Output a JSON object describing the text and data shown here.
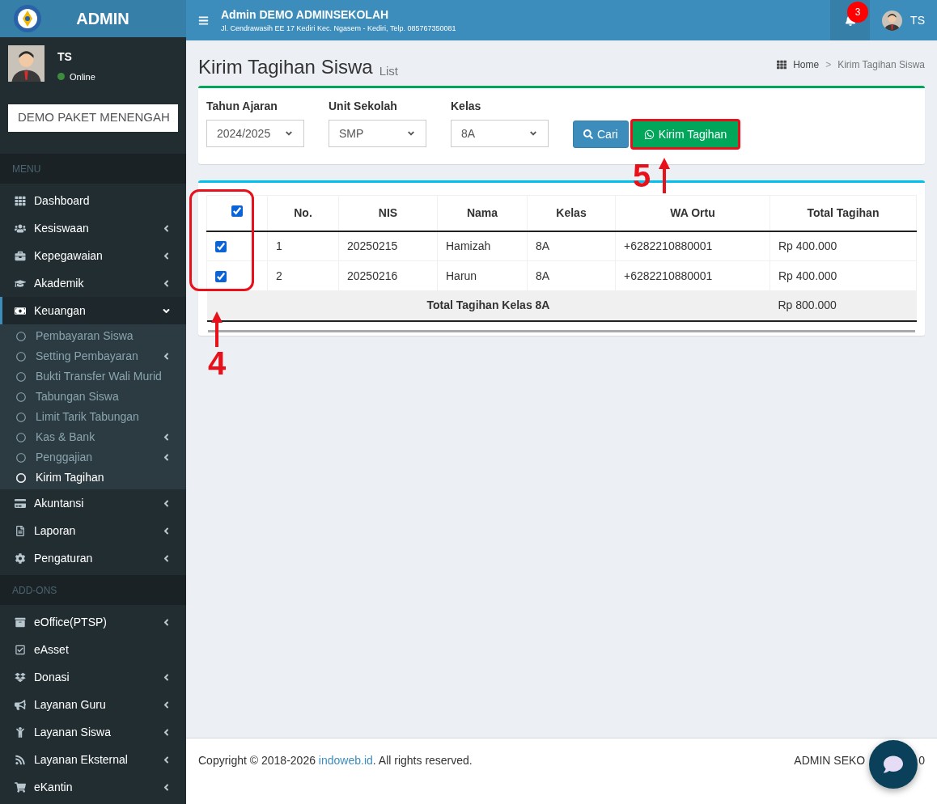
{
  "brand": {
    "title": "ADMIN"
  },
  "navbar": {
    "school": "Admin DEMO ADMINSEKOLAH",
    "address": "Jl. Cendrawasih EE 17 Kediri Kec. Ngasem - Kediri, Telp. 085767350081",
    "notifications": "3",
    "user": "TS"
  },
  "user_panel": {
    "name": "TS",
    "status": "Online"
  },
  "package_select": {
    "value": "DEMO PAKET MENENGAH"
  },
  "sidebar": [
    {
      "header": "MENU",
      "items": [
        {
          "label": "Dashboard",
          "selected": false
        },
        {
          "label": "Kesiswaan",
          "selected": false,
          "expanded": false
        },
        {
          "label": "Kepegawaian",
          "selected": false,
          "expanded": false
        },
        {
          "label": "Akademik",
          "selected": false,
          "expanded": false
        },
        {
          "label": "Keuangan",
          "selected": true,
          "expanded": true,
          "children": [
            {
              "label": "Pembayaran Siswa",
              "selected": false
            },
            {
              "label": "Setting Pembayaran",
              "selected": false,
              "expanded": false
            },
            {
              "label": "Bukti Transfer Wali Murid",
              "selected": false
            },
            {
              "label": "Tabungan Siswa",
              "selected": false
            },
            {
              "label": "Limit Tarik Tabungan",
              "selected": false
            },
            {
              "label": "Kas & Bank",
              "selected": false,
              "expanded": false
            },
            {
              "label": "Penggajian",
              "selected": false,
              "expanded": false
            },
            {
              "label": "Kirim Tagihan",
              "selected": true
            }
          ]
        },
        {
          "label": "Akuntansi",
          "selected": false,
          "expanded": false
        },
        {
          "label": "Laporan",
          "selected": false,
          "expanded": false
        },
        {
          "label": "Pengaturan",
          "selected": false,
          "expanded": false
        }
      ]
    },
    {
      "header": "ADD-ONS",
      "items": [
        {
          "label": "eOffice(PTSP)",
          "selected": false,
          "expanded": false
        },
        {
          "label": "eAsset",
          "selected": false
        },
        {
          "label": "Donasi",
          "selected": false,
          "expanded": false
        },
        {
          "label": "Layanan Guru",
          "selected": false,
          "expanded": false
        },
        {
          "label": "Layanan Siswa",
          "selected": false,
          "expanded": false
        },
        {
          "label": "Layanan Eksternal",
          "selected": false,
          "expanded": false
        },
        {
          "label": "eKantin",
          "selected": false,
          "expanded": false
        }
      ]
    }
  ],
  "page": {
    "title": "Kirim Tagihan Siswa",
    "subtitle": "List"
  },
  "breadcrumb": [
    {
      "label": "Home"
    },
    {
      "label": "Kirim Tagihan Siswa"
    }
  ],
  "breadcrumb_separator": ">",
  "filters": [
    {
      "label": "Tahun Ajaran",
      "value": "2024/2025"
    },
    {
      "label": "Unit Sekolah",
      "value": "SMP"
    },
    {
      "label": "Kelas",
      "value": "8A"
    }
  ],
  "buttons": {
    "search": "Cari",
    "send": "Kirim Tagihan"
  },
  "table": {
    "select_all_checked": true,
    "columns": [
      "No.",
      "NIS",
      "Nama",
      "Kelas",
      "WA Ortu",
      "Total Tagihan"
    ],
    "rows": [
      {
        "checked": true,
        "cells": [
          "1",
          "20250215",
          "Hamizah",
          "8A",
          "+6282210880001",
          "Rp 400.000"
        ]
      },
      {
        "checked": true,
        "cells": [
          "2",
          "20250216",
          "Harun",
          "8A",
          "+6282210880001",
          "Rp 400.000"
        ]
      }
    ],
    "total_label": "Total Tagihan Kelas 8A",
    "total_value": "Rp 800.000"
  },
  "annotations": [
    {
      "label": "4"
    },
    {
      "label": "5"
    }
  ],
  "footer": {
    "copyright_before": "Copyright © 2018-2026 ",
    "link": "indoweb.id",
    "copyright_after": ". All rights reserved.",
    "right_start": "ADMIN SEKO",
    "right_end": "0"
  }
}
